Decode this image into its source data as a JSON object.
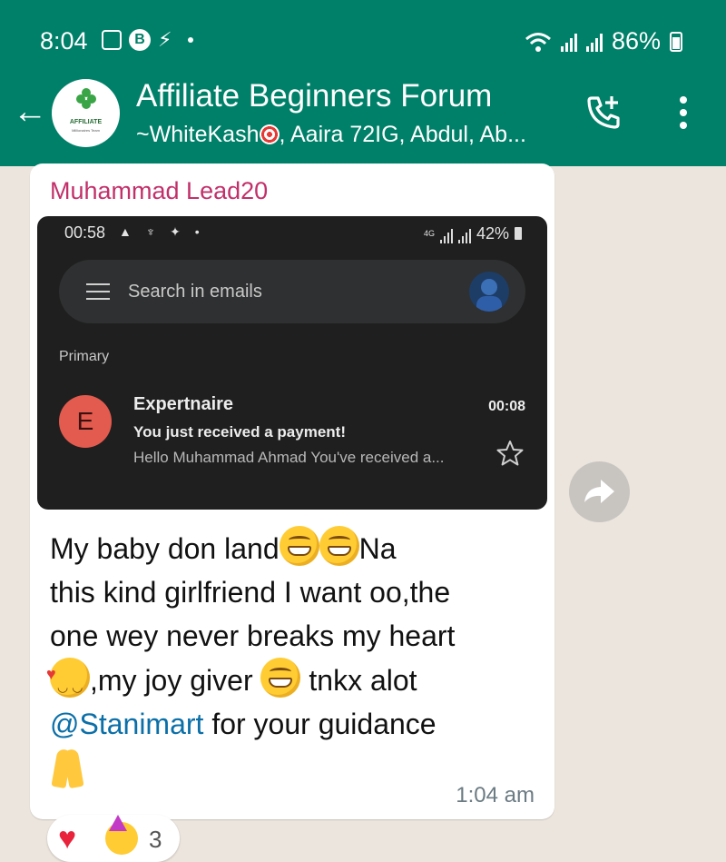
{
  "status_bar": {
    "time": "8:04",
    "battery": "86%",
    "icons_left": [
      "gallery-icon",
      "b-app-icon",
      "bolt-icon",
      "dot-icon"
    ],
    "icons_right": [
      "wifi-icon",
      "signal-icon",
      "signal-icon",
      "battery-icon"
    ]
  },
  "header": {
    "title": "Affiliate Beginners Forum",
    "members_prefix": "~WhiteKash",
    "members_suffix": ", Aaira 72IG, Abdul, Ab...",
    "avatar_label": "AFFILIATE",
    "avatar_sublabel": "Millionaires Team",
    "accent_color": "#008069"
  },
  "message": {
    "sender": "Muhammad Lead20",
    "sender_color": "#c2306a",
    "text_line1": "My baby don land",
    "text_line1_end": "Na",
    "text_line2": "this kind girlfriend I want oo,the",
    "text_line3": "one wey never breaks my heart",
    "text_line4a": ",my joy giver",
    "text_line4b": "tnkx alot",
    "mention": "@Stanimart",
    "text_line5": "for your guidance",
    "time": "1:04 am",
    "mention_color": "#0b6fa8"
  },
  "screenshot": {
    "time": "00:58",
    "network": "4G",
    "battery": "42%",
    "search_placeholder": "Search in emails",
    "section_label": "Primary",
    "email": {
      "avatar_letter": "E",
      "sender": "Expertnaire",
      "time": "00:08",
      "subject": "You just received a payment!",
      "preview": "Hello Muhammad Ahmad You've received a..."
    }
  },
  "reactions": {
    "count": "3",
    "emojis": [
      "heart-icon",
      "party-face-icon"
    ]
  }
}
